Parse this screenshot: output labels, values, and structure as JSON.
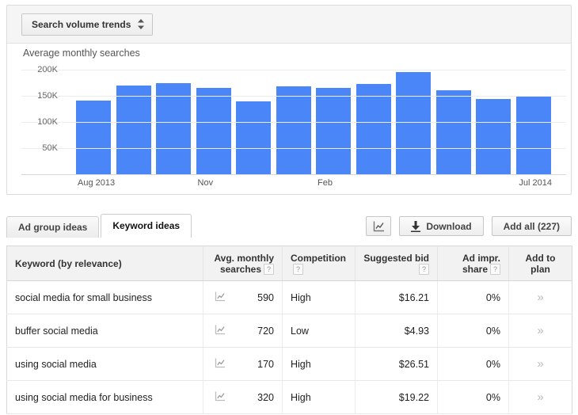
{
  "chart_panel": {
    "metric_select": {
      "label": "Search volume trends",
      "icon": "updown-arrows-icon"
    },
    "title": "Average monthly searches"
  },
  "chart_data": {
    "type": "bar",
    "title": "Average monthly searches",
    "xlabel": "",
    "ylabel": "",
    "ylim": [
      0,
      220000
    ],
    "grid": true,
    "legend": "none",
    "ytick_labels": [
      "200K",
      "150K",
      "100K",
      "50K"
    ],
    "ytick_values": [
      200000,
      150000,
      100000,
      50000
    ],
    "xtick_labels": [
      "Aug 2013",
      "Nov",
      "Feb",
      "Jul 2014"
    ],
    "xtick_indices": [
      0,
      3,
      6,
      11
    ],
    "categories": [
      "Aug 2013",
      "Sep 2013",
      "Oct 2013",
      "Nov 2013",
      "Dec 2013",
      "Jan 2014",
      "Feb 2014",
      "Mar 2014",
      "Apr 2014",
      "May 2014",
      "Jun 2014",
      "Jul 2014"
    ],
    "values": [
      141000,
      170000,
      175000,
      165000,
      140000,
      168000,
      165000,
      172000,
      196000,
      160000,
      144000,
      148000
    ],
    "bar_color": "#4a86f8"
  },
  "tabs": [
    {
      "label": "Ad group ideas",
      "active": false
    },
    {
      "label": "Keyword ideas",
      "active": true
    }
  ],
  "table_actions": {
    "chart_toggle": {
      "label": "",
      "icon": "line-chart-icon"
    },
    "download": {
      "label": "Download",
      "icon": "download-icon"
    },
    "add_all": {
      "label": "Add all (227)"
    }
  },
  "table": {
    "columns": [
      {
        "label": "Keyword (by relevance)",
        "align": "left",
        "help": false
      },
      {
        "label": "Avg. monthly searches",
        "align": "right",
        "help": true
      },
      {
        "label": "Competition",
        "align": "left",
        "help": true
      },
      {
        "label": "Suggested bid",
        "align": "right",
        "help": true
      },
      {
        "label": "Ad impr. share",
        "align": "right",
        "help": true
      },
      {
        "label": "Add to plan",
        "align": "center",
        "help": false
      }
    ],
    "help_badge": "?",
    "trend_icon": "line-chart-icon",
    "add_icon": "double-chevron-right-icon",
    "rows": [
      {
        "keyword": "social media for small business",
        "avg_monthly_searches": "590",
        "competition": "High",
        "suggested_bid": "$16.21",
        "ad_impr_share": "0%"
      },
      {
        "keyword": "buffer social media",
        "avg_monthly_searches": "720",
        "competition": "Low",
        "suggested_bid": "$4.93",
        "ad_impr_share": "0%"
      },
      {
        "keyword": "using social media",
        "avg_monthly_searches": "170",
        "competition": "High",
        "suggested_bid": "$26.51",
        "ad_impr_share": "0%"
      },
      {
        "keyword": "using social media for business",
        "avg_monthly_searches": "320",
        "competition": "High",
        "suggested_bid": "$19.22",
        "ad_impr_share": "0%"
      }
    ]
  }
}
